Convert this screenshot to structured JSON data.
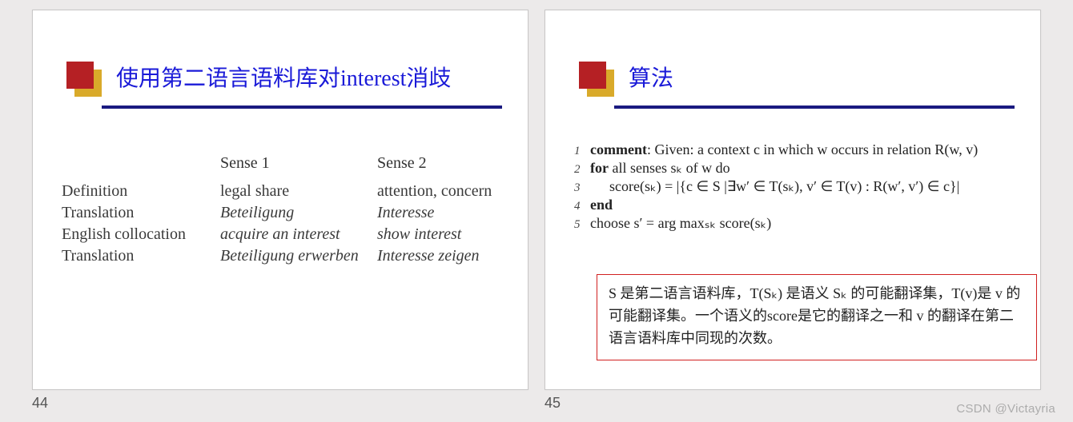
{
  "slides": {
    "left": {
      "title": "使用第二语言语料库对interest消歧",
      "page_number": "44",
      "table": {
        "headers": [
          "",
          "Sense 1",
          "Sense 2"
        ],
        "rows": [
          {
            "label": "Definition",
            "s1": "legal share",
            "s2": "attention, concern",
            "italic": false
          },
          {
            "label": "Translation",
            "s1": "Beteiligung",
            "s2": "Interesse",
            "italic": true
          },
          {
            "label": "English collocation",
            "s1": "acquire an interest",
            "s2": "show interest",
            "italic": true
          },
          {
            "label": "Translation",
            "s1": "Beteiligung erwerben",
            "s2": "Interesse zeigen",
            "italic": true
          }
        ]
      }
    },
    "right": {
      "title": "算法",
      "page_number": "45",
      "algo": {
        "lines": [
          {
            "n": "1",
            "prefix_bold": "comment",
            "rest": ": Given: a context c in which w occurs in relation R(w, v)"
          },
          {
            "n": "2",
            "prefix_bold": "for",
            "rest": " all senses sₖ of w do"
          },
          {
            "n": "3",
            "prefix_bold": "",
            "rest": "score(sₖ) = |{c ∈ S |∃w′ ∈ T(sₖ), v′ ∈ T(v) : R(w′, v′) ∈ c}|",
            "indent": true
          },
          {
            "n": "4",
            "prefix_bold": "end",
            "rest": ""
          },
          {
            "n": "5",
            "prefix_bold": "",
            "rest": "choose s′ = arg maxₛₖ score(sₖ)"
          }
        ]
      },
      "note": {
        "text": "S 是第二语言语料库，T(Sₖ) 是语义 Sₖ 的可能翻译集，T(v)是 v 的可能翻译集。一个语义的score是它的翻译之一和 v 的翻译在第二语言语料库中同现的次数。"
      }
    }
  },
  "watermark": "CSDN @Victayria"
}
